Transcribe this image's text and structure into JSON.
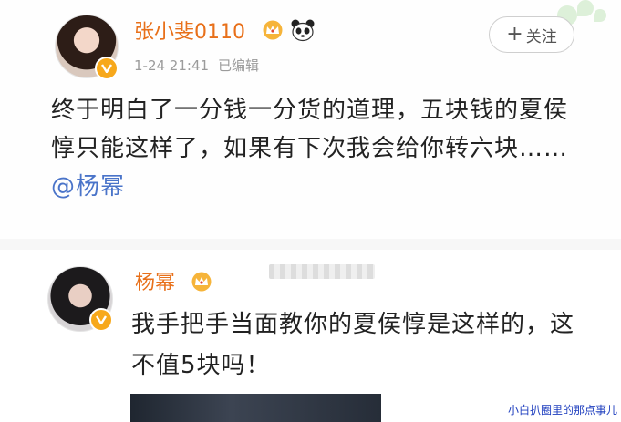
{
  "post": {
    "author": "张小斐0110",
    "timestamp": "1-24 21:41",
    "edited_label": "已编辑",
    "follow_label": "关注",
    "text": "终于明白了一分钱一分货的道理，五块钱的夏侯惇只能这样了，如果有下次我会给你转六块……",
    "mention": "@杨幂"
  },
  "comment": {
    "author": "杨幂",
    "text": "我手把手当面教你的夏侯惇是这样的，这不值5块吗！"
  },
  "watermark": "小白扒圈里的那点事儿",
  "colors": {
    "name": "#e8701a",
    "mention": "#4a74c9",
    "verified_badge": "#f7a81b",
    "watermark": "#1f3fbf"
  },
  "icons": {
    "verified": "verified-v-icon",
    "member_crown": "crown-icon",
    "panda": "panda-icon",
    "follow_plus": "plus-icon"
  }
}
